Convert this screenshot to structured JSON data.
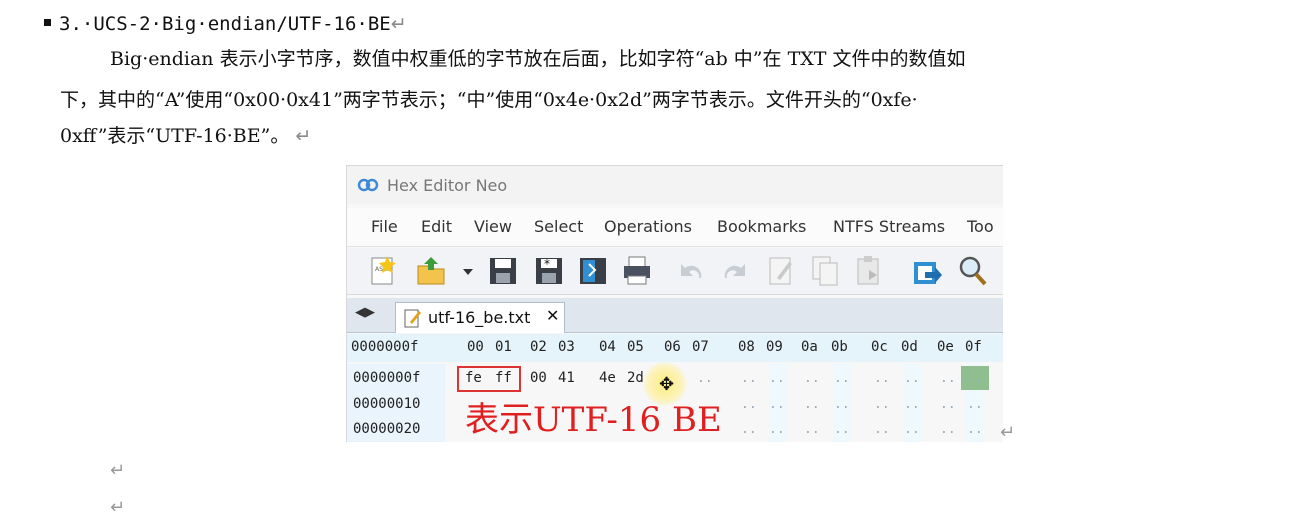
{
  "heading": {
    "text": "3.·UCS-2·Big·endian/UTF-16·BE",
    "return_mark": "↵"
  },
  "paragraph": {
    "line1": "Big·endian 表示小字节序，数值中权重低的字节放在后面，比如字符“ab 中”在 TXT 文件中的数值如",
    "line2": "下，其中的“A”使用“0x00·0x41”两字节表示；“中”使用“0x4e·0x2d”两字节表示。文件开头的“0xfe·",
    "line3": "0xff”表示“UTF-16·BE”。",
    "line3_mark": "↵"
  },
  "screenshot": {
    "app_title": "Hex Editor Neo",
    "menu": [
      "File",
      "Edit",
      "View",
      "Select",
      "Operations",
      "Bookmarks",
      "NTFS Streams",
      "Too"
    ],
    "toolbar_icons": [
      "new-file-icon",
      "open-file-icon",
      "dropdown-arrow-icon",
      "save-icon",
      "save-all-icon",
      "save-as-icon",
      "print-icon",
      "undo-icon",
      "redo-icon",
      "edit-icon",
      "copy-icon",
      "paste-icon",
      "export-icon",
      "find-icon"
    ],
    "tab": {
      "nav": "◀▶",
      "label": "utf-16_be.txt",
      "close": "✕"
    },
    "hex_header": {
      "offset": "0000000f",
      "columns": [
        "00",
        "01",
        "02",
        "03",
        "04",
        "05",
        "06",
        "07",
        "08",
        "09",
        "0a",
        "0b",
        "0c",
        "0d",
        "0e",
        "0f"
      ]
    },
    "rows": [
      {
        "offset": "0000000f",
        "bytes": [
          "fe",
          "ff",
          "00",
          "41",
          "4e",
          "2d"
        ]
      },
      {
        "offset": "00000010"
      },
      {
        "offset": "00000020"
      }
    ],
    "dots": "..",
    "annotation": "表示UTF-16 BE",
    "cursor": "✥"
  },
  "trailing_marks": [
    "↵",
    "↵",
    "↵"
  ]
}
